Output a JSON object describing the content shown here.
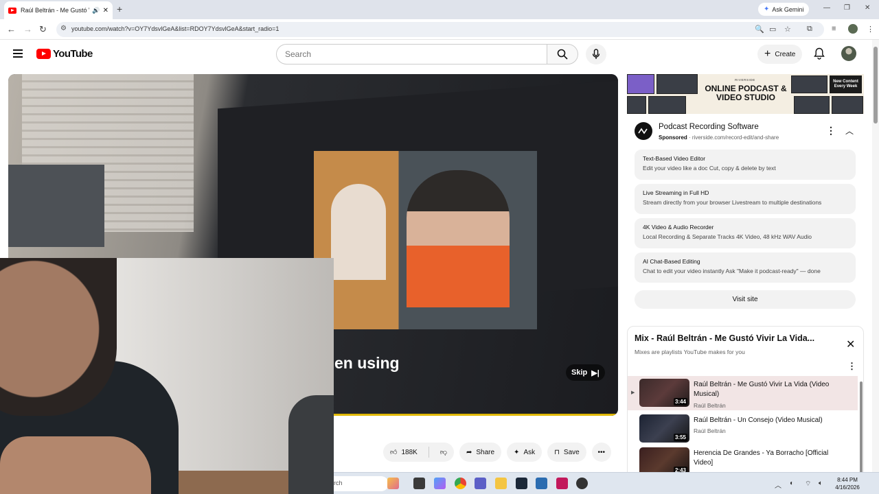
{
  "browser": {
    "tab_title": "Raúl Beltrán - Me Gustó Vi",
    "url": "youtube.com/watch?v=OY7YdsvlGeA&list=RDOY7YdsvlGeA&start_radio=1",
    "ask_gemini_label": "Ask Gemini",
    "new_tab_glyph": "+"
  },
  "youtube": {
    "logo_text": "YouTube",
    "search_placeholder": "Search",
    "create_label": "Create"
  },
  "video": {
    "caption": "en using",
    "skip_label": "Skip"
  },
  "actions": {
    "like_count": "188K",
    "share_label": "Share",
    "ask_label": "Ask",
    "save_label": "Save"
  },
  "ad": {
    "brand": "RIVERSIDE",
    "banner_headline": "ONLINE PODCAST & VIDEO STUDIO",
    "banner_badge": "New Content Every Week",
    "title": "Podcast Recording Software",
    "sponsored_label": "Sponsored",
    "domain": "riverside.com/record-edit/and-share",
    "features": [
      {
        "title": "Text-Based Video Editor",
        "desc": "Edit your video like a doc Cut, copy & delete by text"
      },
      {
        "title": "Live Streaming in Full HD",
        "desc": "Stream directly from your browser Livestream to multiple destinations"
      },
      {
        "title": "4K Video & Audio Recorder",
        "desc": "Local Recording & Separate Tracks 4K Video, 48 kHz WAV Audio"
      },
      {
        "title": "AI Chat-Based Editing",
        "desc": "Chat to edit your video instantly Ask \"Make it podcast-ready\" — done"
      }
    ],
    "visit_label": "Visit site"
  },
  "mix": {
    "title": "Mix - Raúl Beltrán - Me Gustó Vivir La Vida...",
    "subtitle": "Mixes are playlists YouTube makes for you",
    "items": [
      {
        "title": "Raúl Beltrán - Me Gustó Vivir La Vida (Video Musical)",
        "channel": "Raúl Beltrán",
        "duration": "3:44",
        "active": true
      },
      {
        "title": "Raúl Beltrán - Un Consejo (Video Musical)",
        "channel": "Raúl Beltrán",
        "duration": "3:55",
        "active": false
      },
      {
        "title": "Herencia De Grandes - Ya Borracho [Official Video]",
        "channel": "",
        "duration": "2:43",
        "active": false
      }
    ]
  },
  "taskbar": {
    "search_text": "rch",
    "time": "8:44 PM",
    "date": "4/16/2026"
  },
  "colors": {
    "brand_red": "#ff0000",
    "active_row": "#f2e5e5",
    "progress": "#e0b800"
  }
}
